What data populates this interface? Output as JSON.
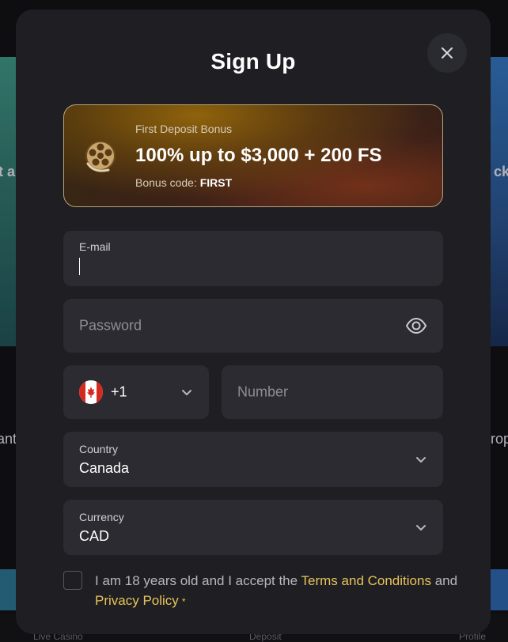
{
  "background": {
    "left_snippet_1": "t a",
    "left_snippet_2": "ant",
    "right_snippet_1": "ck",
    "right_snippet_2": "rop",
    "nav": {
      "live_casino": "Live Casino",
      "deposit": "Deposit",
      "profile": "Profile"
    }
  },
  "modal": {
    "title": "Sign Up",
    "close_icon": "close-icon",
    "bonus": {
      "subtitle": "First Deposit Bonus",
      "headline": "100% up to $3,000 + 200 FS",
      "code_label": "Bonus code:",
      "code_value": "FIRST",
      "icon": "film-reel-icon"
    },
    "email": {
      "label": "E-mail",
      "value": ""
    },
    "password": {
      "placeholder": "Password",
      "icon": "eye-icon"
    },
    "phone": {
      "country_flag": "canada-flag-icon",
      "dial_code": "+1",
      "number_placeholder": "Number"
    },
    "country": {
      "label": "Country",
      "value": "Canada"
    },
    "currency": {
      "label": "Currency",
      "value": "CAD"
    },
    "consent": {
      "text_prefix": "I am 18 years old and I accept the",
      "terms_link": "Terms and Conditions",
      "and": "and",
      "privacy_link": "Privacy Policy",
      "required_marker": "*"
    }
  },
  "colors": {
    "modal_bg": "#1e1e23",
    "input_bg": "#2b2b31",
    "accent_link": "#e8c45a"
  }
}
